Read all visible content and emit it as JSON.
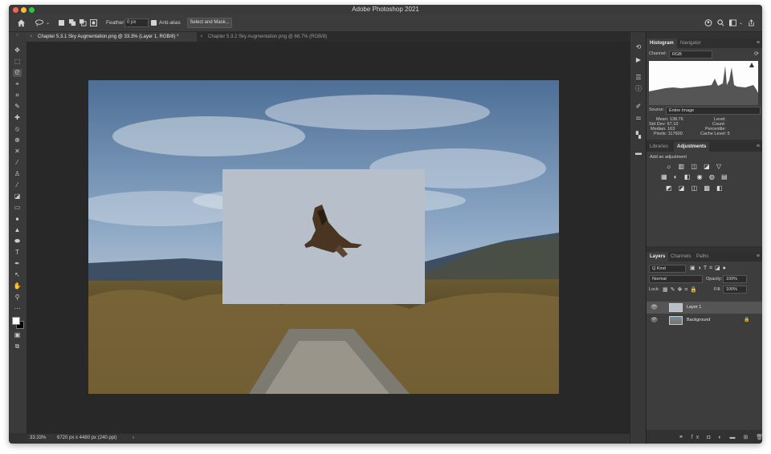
{
  "window": {
    "title": "Adobe Photoshop 2021",
    "traffic_colors": [
      "#fe5f57",
      "#febc2e",
      "#28c840"
    ]
  },
  "options_bar": {
    "feather_label": "Feather:",
    "feather_value": "0 px",
    "anti_alias_label": "Anti-alias",
    "select_mask_button": "Select and Mask..."
  },
  "tabs": [
    {
      "close": "×",
      "label": "Chapter 5.3.1 Sky Augmentation.png @ 33.3% (Layer 1, RGB/8) *",
      "active": true
    },
    {
      "close": "×",
      "label": "Chapter 5.3.2 Sky Augmentation.png @ 66.7% (RGB/8)",
      "active": false
    }
  ],
  "status": {
    "zoom": "33.33%",
    "dimensions": "6720 px x 4480 px (240 ppi)",
    "arrow": "›"
  },
  "histogram_panel": {
    "tabs": [
      "Histogram",
      "Navigator"
    ],
    "channel_label": "Channel:",
    "channel_value": "RGB",
    "source_label": "Source:",
    "source_value": "Entire Image",
    "stats_left": [
      {
        "label": "Mean:",
        "value": "138.76"
      },
      {
        "label": "Std Dev:",
        "value": "67.10"
      },
      {
        "label": "Median:",
        "value": "163"
      },
      {
        "label": "Pixels:",
        "value": "117600"
      }
    ],
    "stats_right": [
      {
        "label": "Level:",
        "value": ""
      },
      {
        "label": "Count:",
        "value": ""
      },
      {
        "label": "Percentile:",
        "value": ""
      },
      {
        "label": "Cache Level:",
        "value": "5"
      }
    ]
  },
  "adjustments_panel": {
    "tabs": [
      "Libraries",
      "Adjustments"
    ],
    "add_label": "Add an adjustment",
    "row1": "☼ ▥ ◫ ◪ ▽",
    "row2": "▦ ◐ ◧ ◉ ◍ ▤",
    "row3": "◩ ◪ ◫ ▩ ◧"
  },
  "layers_panel": {
    "tabs": [
      "Layers",
      "Channels",
      "Paths"
    ],
    "kind_value": "Q Kind",
    "blend_mode": "Normal",
    "opacity_label": "Opacity:",
    "opacity_value": "100%",
    "lock_label": "Lock:",
    "fill_label": "Fill:",
    "fill_value": "100%",
    "layers": [
      {
        "name": "Layer 1",
        "selected": true
      },
      {
        "name": "Background",
        "selected": false
      }
    ],
    "lock_icon": "🔒",
    "bottom_icons": "⚭ fx ◘ ◐ ▬ ⊞ 🗑"
  },
  "colors": {
    "accent": "#4a88d8",
    "layer1_fill": "#b6bfca"
  }
}
